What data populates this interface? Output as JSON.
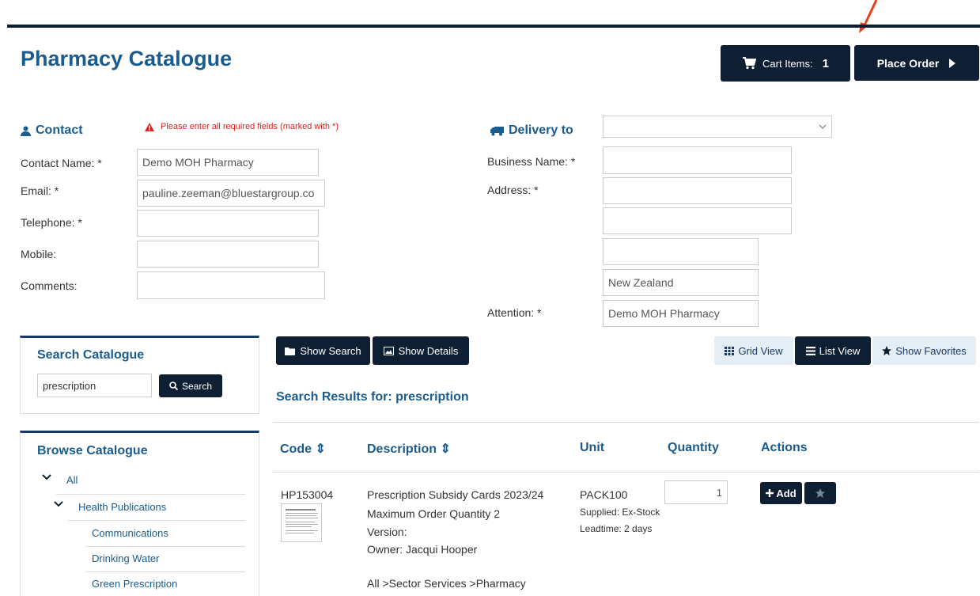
{
  "header": {
    "title": "Pharmacy Catalogue",
    "cart_label": "Cart Items:",
    "cart_count": "1",
    "place_order": "Place Order"
  },
  "contact": {
    "heading": "Contact",
    "warning": "Please enter all required fields (marked with *)",
    "name_label": "Contact Name: *",
    "name_value": "Demo MOH Pharmacy",
    "email_label": "Email: *",
    "email_value": "pauline.zeeman@bluestargroup.co",
    "telephone_label": "Telephone: *",
    "telephone_value": "",
    "mobile_label": "Mobile:",
    "mobile_value": "",
    "comments_label": "Comments:",
    "comments_value": ""
  },
  "delivery": {
    "heading": "Delivery to",
    "select_value": "",
    "business_label": "Business Name: *",
    "business_value": "",
    "address_label": "Address: *",
    "address1": "",
    "address2": "",
    "address3": "",
    "country": "New Zealand",
    "attention_label": "Attention: *",
    "attention_value": "Demo MOH Pharmacy"
  },
  "search_panel": {
    "heading": "Search Catalogue",
    "query": "prescription",
    "button": "Search"
  },
  "browse": {
    "heading": "Browse Catalogue",
    "items": [
      "All",
      "Health Publications",
      "Communications",
      "Drinking Water",
      "Green Prescription"
    ]
  },
  "toolbar": {
    "show_search": "Show Search",
    "show_details": "Show Details",
    "grid_view": "Grid View",
    "list_view": "List View",
    "show_favorites": "Show Favorites"
  },
  "results": {
    "heading": "Search Results for: prescription",
    "columns": [
      "Code ⇕",
      "Description ⇕",
      "Unit",
      "Quantity",
      "Actions"
    ],
    "row": {
      "code": "HP153004",
      "description": "Prescription Subsidy Cards 2023/24",
      "max_qty": "Maximum Order Quantity 2",
      "version": "Version:",
      "owner": "Owner: Jacqui Hooper",
      "path": "All >Sector Services >Pharmacy",
      "unit": "PACK100",
      "supplied": "Supplied: Ex-Stock",
      "leadtime": "Leadtime: 2 days",
      "quantity": "1",
      "add": "Add"
    }
  },
  "colors": {
    "navy": "#0f1f33",
    "brand_blue": "#1a5c8e",
    "warning_red": "#e02020",
    "arrow": "#e8401c"
  }
}
